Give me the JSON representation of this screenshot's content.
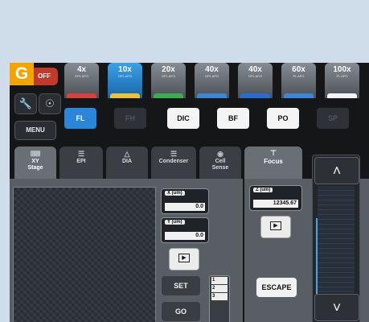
{
  "figure_label": "G",
  "power": {
    "label": "OFF"
  },
  "menu": {
    "label": "MENU"
  },
  "objectives": [
    {
      "mag": "4x",
      "sub": "OPL APO",
      "ring": "#d8413a",
      "active": false
    },
    {
      "mag": "10x",
      "sub": "OPL APO",
      "ring": "#e7c23a",
      "active": true
    },
    {
      "mag": "20x",
      "sub": "OPL APO",
      "ring": "#3bab4e",
      "active": false
    },
    {
      "mag": "40x",
      "sub": "OPL APO",
      "ring": "#3b87d6",
      "active": false
    },
    {
      "mag": "40x",
      "sub": "OPL APO",
      "ring": "#2a6bd0",
      "active": false
    },
    {
      "mag": "60x",
      "sub": "PL APO",
      "ring": "#3b87d6",
      "active": false
    },
    {
      "mag": "100x",
      "sub": "PL APO",
      "ring": "#f3f3f3",
      "active": false
    }
  ],
  "modes": [
    "FL",
    "FH",
    "DIC",
    "BF",
    "PO",
    "SP"
  ],
  "tabs": [
    {
      "label": "XY\nStage"
    },
    {
      "label": "EPI"
    },
    {
      "label": "DIA"
    },
    {
      "label": "Condenser"
    },
    {
      "label": "Cell\nSense"
    }
  ],
  "focus_tab": {
    "label": "Focus"
  },
  "stage": {
    "x_label": "X (um)",
    "x_value": "0.0",
    "y_label": "Y (um)",
    "y_value": "0.0",
    "set_label": "SET",
    "go_label": "GO",
    "memory_slots": [
      "1",
      "2",
      "3"
    ]
  },
  "focus": {
    "z_label": "Z (um)",
    "z_value": "12345.67",
    "escape_label": "ESCAPE"
  }
}
